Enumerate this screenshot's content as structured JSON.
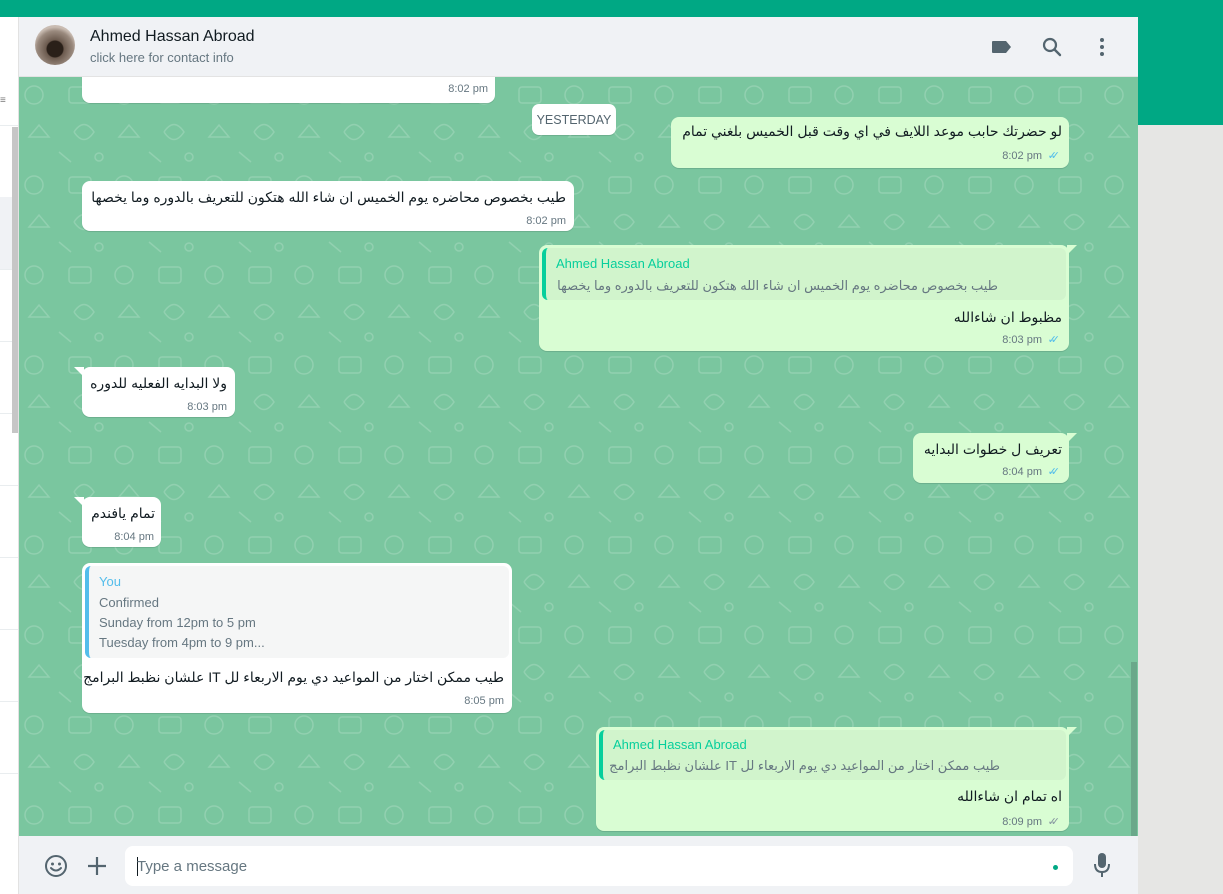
{
  "colors": {
    "brand_green": "#00a884",
    "chat_background": "#7ac69f",
    "outgoing_bubble": "#d9fdd3",
    "incoming_bubble": "#ffffff",
    "read_ticks": "#53bdeb",
    "quote_author_outgoing": "#06cf9c",
    "quote_author_you": "#53bdeb"
  },
  "header": {
    "contact_name": "Ahmed Hassan Abroad",
    "contact_subtitle": "click here for contact info",
    "icons": [
      "label-icon",
      "search-icon",
      "menu-icon"
    ]
  },
  "chat": {
    "date_divider": "YESTERDAY",
    "messages": [
      {
        "direction": "in",
        "time": "8:02 pm"
      },
      {
        "direction": "out",
        "text": "لو حضرتك حابب موعد اللايف في اي وقت قبل الخميس بلغني تمام",
        "time": "8:02 pm",
        "status": "read"
      },
      {
        "direction": "in",
        "text": "طيب بخصوص محاضره يوم الخميس ان شاء الله هتكون للتعريف بالدوره وما يخصها",
        "time": "8:02 pm"
      },
      {
        "direction": "out",
        "quote": {
          "author": "Ahmed Hassan Abroad",
          "text": "طيب بخصوص محاضره يوم الخميس ان شاء الله هتكون للتعريف بالدوره وما يخصها"
        },
        "text": "مظبوط ان شاءالله",
        "time": "8:03 pm",
        "status": "read"
      },
      {
        "direction": "in",
        "text": "ولا البدايه الفعليه للدوره",
        "time": "8:03 pm"
      },
      {
        "direction": "out",
        "text": "تعريف ل خطوات البدايه",
        "time": "8:04 pm",
        "status": "read"
      },
      {
        "direction": "in",
        "text": "تمام يافندم",
        "time": "8:04 pm"
      },
      {
        "direction": "in",
        "quote": {
          "author": "You",
          "lines": [
            "Confirmed",
            "Sunday from 12pm to 5 pm",
            "Tuesday from 4pm to 9 pm..."
          ]
        },
        "text": "طيب ممكن اختار من المواعيد دي يوم الاربعاء لل IT علشان نظبط البرامج",
        "time": "8:05 pm"
      },
      {
        "direction": "out",
        "quote": {
          "author": "Ahmed Hassan Abroad",
          "text": "طيب ممكن اختار من المواعيد دي يوم الاربعاء لل IT علشان نظبط البرامج"
        },
        "text": "اه تمام ان شاءالله",
        "time": "8:09 pm",
        "status": "delivered"
      }
    ]
  },
  "footer": {
    "placeholder": "Type a message",
    "icons": [
      "emoji-icon",
      "attach-plus-icon",
      "microphone-icon"
    ]
  }
}
